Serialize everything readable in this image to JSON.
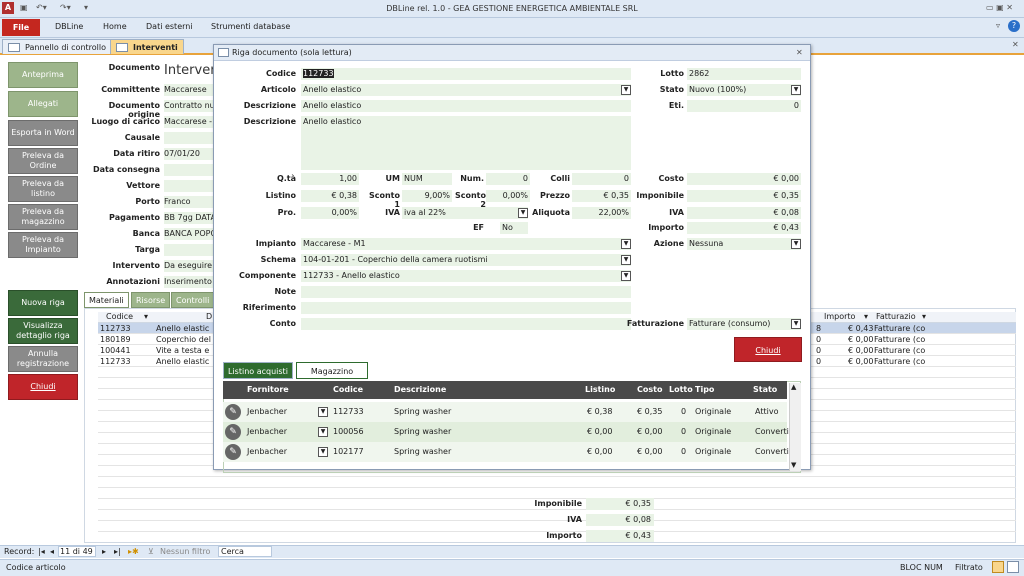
{
  "window": {
    "title": "DBLine rel. 1.0 - GEA GESTIONE ENERGETICA AMBIENTALE SRL"
  },
  "ribbon": {
    "file": "File",
    "tabs": [
      "DBLine",
      "Home",
      "Dati esterni",
      "Strumenti database"
    ]
  },
  "doc_tabs": [
    "Pannello di controllo",
    "Interventi"
  ],
  "left_buttons": [
    "Anteprima",
    "Allegati",
    "Esporta in Word",
    "Preleva da Ordine",
    "Preleva da listino",
    "Preleva da magazzino",
    "Preleva da Impianto"
  ],
  "left_buttons2": [
    "Nuova riga",
    "Visualizza dettaglio riga",
    "Annulla registrazione",
    "Chiudi"
  ],
  "form": {
    "documento_label": "Documento",
    "documento_value": "Intervento",
    "fields": [
      {
        "label": "Committente",
        "value": "Maccarese"
      },
      {
        "label": "Documento origine",
        "value": "Contratto nu"
      },
      {
        "label": "Luogo di carico",
        "value": "Maccarese -"
      },
      {
        "label": "Causale",
        "value": ""
      },
      {
        "label": "Data ritiro",
        "value": "07/01/20"
      },
      {
        "label": "Data consegna",
        "value": ""
      },
      {
        "label": "Vettore",
        "value": ""
      },
      {
        "label": "Porto",
        "value": "Franco"
      },
      {
        "label": "Pagamento",
        "value": "BB 7gg DATA"
      },
      {
        "label": "Banca",
        "value": "BANCA POPO"
      },
      {
        "label": "Targa",
        "value": ""
      },
      {
        "label": "Intervento",
        "value": "Da eseguire"
      },
      {
        "label": "Annotazioni",
        "value": "Inserimento"
      }
    ]
  },
  "subtabs": [
    "Materiali",
    "Risorse",
    "Controlli"
  ],
  "grid": {
    "headers": [
      "Codice",
      "D",
      "Importo",
      "Fatturazio"
    ],
    "rows": [
      {
        "codice": "112733",
        "desc": "Anello elastic",
        "n": "8",
        "importo": "€ 0,43",
        "fatt": "Fatturare (co"
      },
      {
        "codice": "180189",
        "desc": "Coperchio del",
        "n": "0",
        "importo": "€ 0,00",
        "fatt": "Fatturare (co"
      },
      {
        "codice": "100441",
        "desc": "Vite a testa e",
        "n": "0",
        "importo": "€ 0,00",
        "fatt": "Fatturare (co"
      },
      {
        "codice": "112733",
        "desc": "Anello elastic",
        "n": "0",
        "importo": "€ 0,00",
        "fatt": "Fatturare (co"
      }
    ]
  },
  "totals": [
    {
      "label": "Imponibile",
      "value": "€ 0,35"
    },
    {
      "label": "IVA",
      "value": "€ 0,08"
    },
    {
      "label": "Importo",
      "value": "€ 0,43"
    }
  ],
  "recnav": {
    "label": "Record:",
    "pos": "11 di 49",
    "filter": "Nessun filtro",
    "search": "Cerca"
  },
  "status": {
    "left": "Codice articolo",
    "bloc": "BLOC NUM",
    "filtrato": "Filtrato"
  },
  "dialog": {
    "title": "Riga documento (sola lettura)",
    "codice_l": "Codice",
    "codice": "112733",
    "articolo_l": "Articolo",
    "articolo": "Anello elastico",
    "descrizione_l": "Descrizione",
    "descrizione": "Anello elastico",
    "descrizione2_l": "Descrizione",
    "descrizione2": "Anello elastico",
    "lotto_l": "Lotto",
    "lotto": "2862",
    "stato_l": "Stato",
    "stato": "Nuovo (100%)",
    "eti_l": "Eti.",
    "eti": "0",
    "qta_l": "Q.tà",
    "qta": "1,00",
    "um_l": "UM",
    "um": "NUM",
    "num_l": "Num.",
    "num": "0",
    "colli_l": "Colli",
    "colli": "0",
    "costo_l": "Costo",
    "costo": "€ 0,00",
    "listino_l": "Listino",
    "listino": "€ 0,38",
    "sconto1_l": "Sconto 1",
    "sconto1": "9,00%",
    "sconto2_l": "Sconto 2",
    "sconto2": "0,00%",
    "prezzo_l": "Prezzo",
    "prezzo": "€ 0,35",
    "imponibile_l": "Imponibile",
    "imponibile": "€ 0,35",
    "pro_l": "Pro.",
    "pro": "0,00%",
    "iva_l": "IVA",
    "iva": "iva al 22%",
    "aliquota_l": "Aliquota",
    "aliquota": "22,00%",
    "iva2_l": "IVA",
    "iva2": "€ 0,08",
    "ef_l": "EF",
    "ef": "No",
    "importo_l": "Importo",
    "importo": "€ 0,43",
    "impianto_l": "Impianto",
    "impianto": "Maccarese - M1",
    "azione_l": "Azione",
    "azione": "Nessuna",
    "schema_l": "Schema",
    "schema": "104-01-201 - Coperchio della camera ruotismi",
    "componente_l": "Componente",
    "componente": "112733 - Anello elastico",
    "note_l": "Note",
    "note": "",
    "riferimento_l": "Riferimento",
    "riferimento": "",
    "conto_l": "Conto",
    "conto": "",
    "fatturazione_l": "Fatturazione",
    "fatturazione": "Fatturare (consumo)",
    "chiudi": "Chiudi",
    "tabs": [
      "Listino acquisti",
      "Magazzino"
    ],
    "table_headers": [
      "Fornitore",
      "Codice",
      "Descrizione",
      "Listino",
      "Costo",
      "Lotto",
      "Tipo",
      "Stato"
    ],
    "table_rows": [
      {
        "fornitore": "Jenbacher",
        "codice": "112733",
        "desc": "Spring washer",
        "listino": "€ 0,38",
        "costo": "€ 0,35",
        "lotto": "0",
        "tipo": "Originale",
        "stato": "Attivo"
      },
      {
        "fornitore": "Jenbacher",
        "codice": "100056",
        "desc": "Spring washer",
        "listino": "€ 0,00",
        "costo": "€ 0,00",
        "lotto": "0",
        "tipo": "Originale",
        "stato": "Converti"
      },
      {
        "fornitore": "Jenbacher",
        "codice": "102177",
        "desc": "Spring washer",
        "listino": "€ 0,00",
        "costo": "€ 0,00",
        "lotto": "0",
        "tipo": "Originale",
        "stato": "Converti"
      }
    ]
  }
}
